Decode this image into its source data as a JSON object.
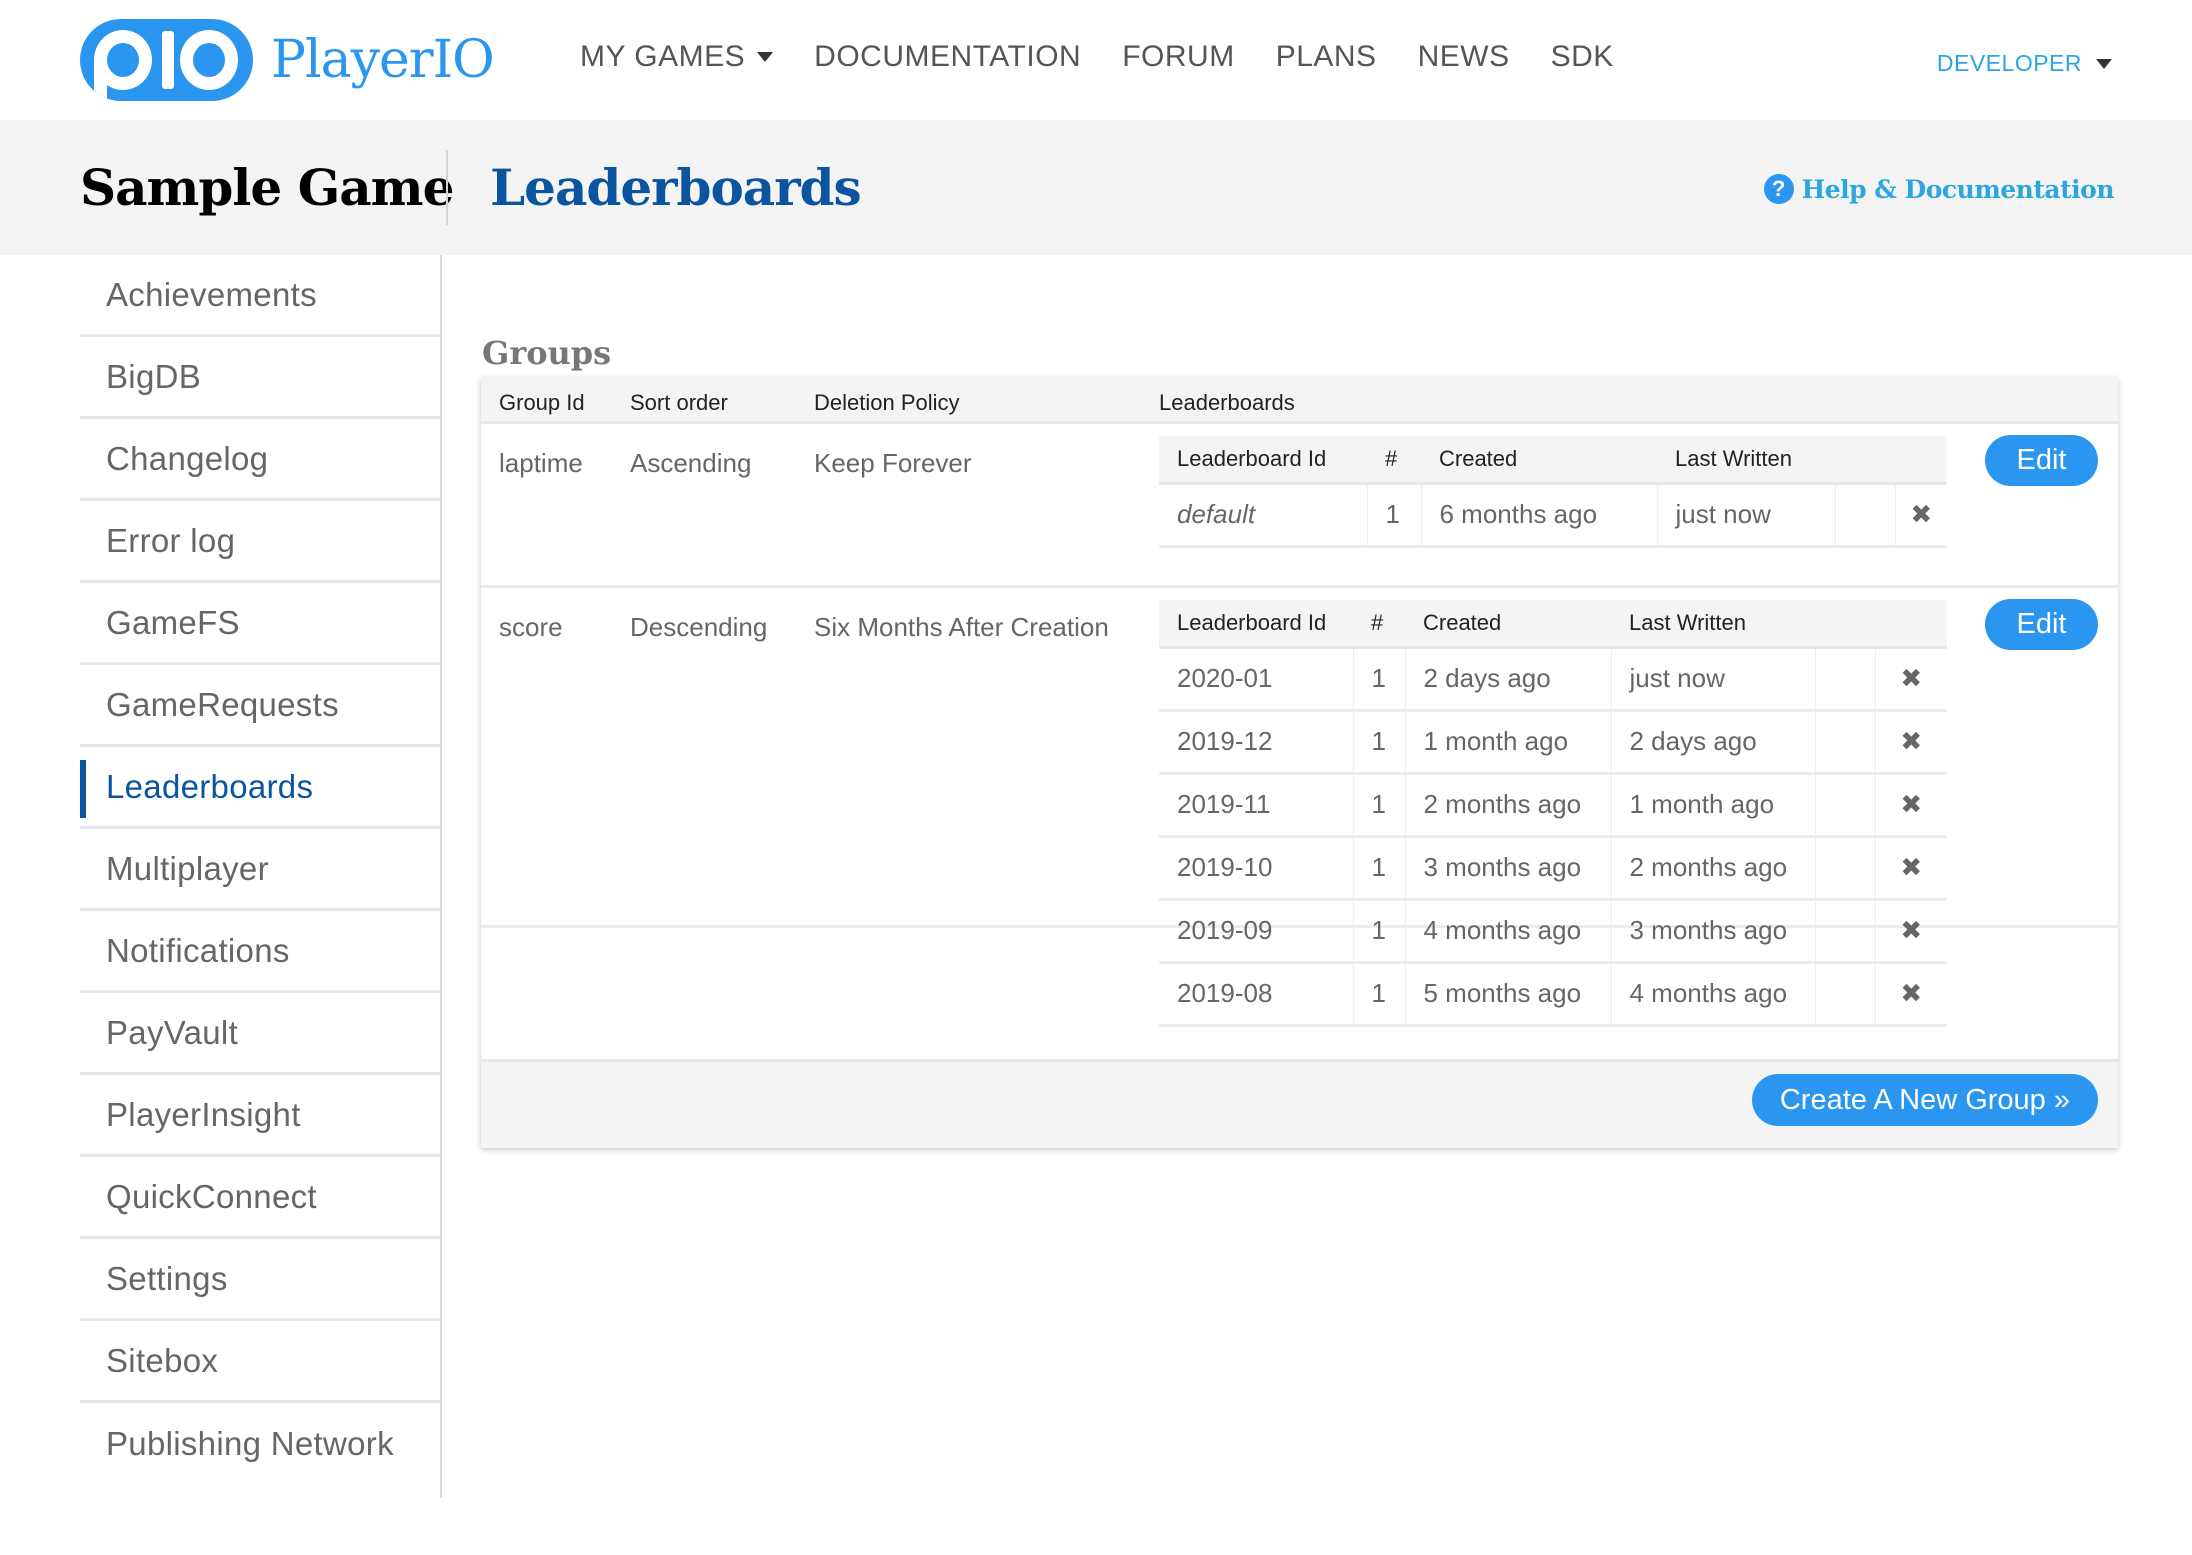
{
  "brand": {
    "name": "PlayerIO",
    "accent": "#2a96f0"
  },
  "nav": {
    "items": [
      {
        "label": "MY GAMES",
        "has_dropdown": true
      },
      {
        "label": "DOCUMENTATION"
      },
      {
        "label": "FORUM"
      },
      {
        "label": "PLANS"
      },
      {
        "label": "NEWS"
      },
      {
        "label": "SDK"
      }
    ],
    "account": {
      "label": "DEVELOPER",
      "has_dropdown": true
    }
  },
  "titlebar": {
    "game": "Sample Game",
    "section": "Leaderboards",
    "help": {
      "icon": "question-circle-icon",
      "label": "Help & Documentation"
    }
  },
  "sidebar": {
    "active": "Leaderboards",
    "items": [
      {
        "label": "Achievements"
      },
      {
        "label": "BigDB"
      },
      {
        "label": "Changelog"
      },
      {
        "label": "Error log"
      },
      {
        "label": "GameFS"
      },
      {
        "label": "GameRequests"
      },
      {
        "label": "Leaderboards"
      },
      {
        "label": "Multiplayer"
      },
      {
        "label": "Notifications"
      },
      {
        "label": "PayVault"
      },
      {
        "label": "PlayerInsight"
      },
      {
        "label": "QuickConnect"
      },
      {
        "label": "Settings"
      },
      {
        "label": "Sitebox"
      },
      {
        "label": "Publishing Network"
      }
    ]
  },
  "groups": {
    "heading": "Groups",
    "columns": [
      "Group Id",
      "Sort order",
      "Deletion Policy",
      "Leaderboards"
    ],
    "leaderboard_columns": [
      "Leaderboard Id",
      "#",
      "Created",
      "Last Written"
    ],
    "edit_label": "Edit",
    "delete_icon": "delete-x-icon",
    "rows": [
      {
        "group_id": "laptime",
        "sort_order": "Ascending",
        "deletion_policy": "Keep Forever",
        "leaderboards": [
          {
            "id": "default",
            "italic": true,
            "count": "1",
            "created": "6 months ago",
            "last_written": "just now"
          }
        ]
      },
      {
        "group_id": "score",
        "sort_order": "Descending",
        "deletion_policy": "Six Months After Creation",
        "leaderboards": [
          {
            "id": "2020-01",
            "count": "1",
            "created": "2 days ago",
            "last_written": "just now"
          },
          {
            "id": "2019-12",
            "count": "1",
            "created": "1 month ago",
            "last_written": "2 days ago"
          },
          {
            "id": "2019-11",
            "count": "1",
            "created": "2 months ago",
            "last_written": "1 month ago"
          },
          {
            "id": "2019-10",
            "count": "1",
            "created": "3 months ago",
            "last_written": "2 months ago"
          },
          {
            "id": "2019-09",
            "count": "1",
            "created": "4 months ago",
            "last_written": "3 months ago"
          },
          {
            "id": "2019-08",
            "count": "1",
            "created": "5 months ago",
            "last_written": "4 months ago"
          }
        ]
      }
    ],
    "create_label": "Create A New Group »"
  }
}
